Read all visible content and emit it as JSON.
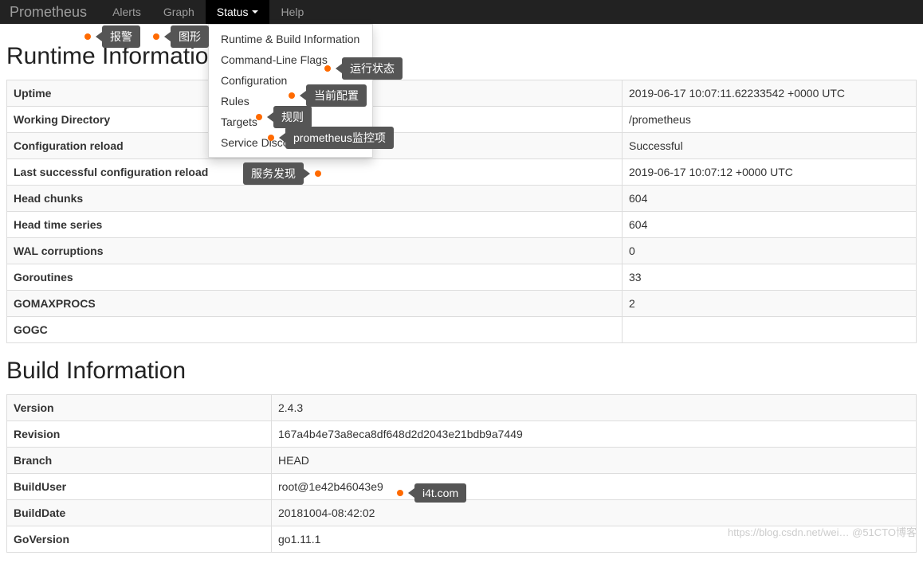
{
  "nav": {
    "brand": "Prometheus",
    "alerts": "Alerts",
    "graph": "Graph",
    "status": "Status",
    "help": "Help"
  },
  "dropdown": {
    "runtime_build": "Runtime & Build Information",
    "cmdline": "Command-Line Flags",
    "config": "Configuration",
    "rules": "Rules",
    "targets": "Targets",
    "sd": "Service Discovery"
  },
  "headings": {
    "runtime": "Runtime Information",
    "build": "Build Information"
  },
  "runtime": {
    "uptime_label": "Uptime",
    "uptime_value": "2019-06-17 10:07:11.62233542 +0000 UTC",
    "workdir_label": "Working Directory",
    "workdir_value": "/prometheus",
    "cfgreload_label": "Configuration reload",
    "cfgreload_value": "Successful",
    "lastcfg_label": "Last successful configuration reload",
    "lastcfg_value": "2019-06-17 10:07:12 +0000 UTC",
    "headchunks_label": "Head chunks",
    "headchunks_value": "604",
    "headseries_label": "Head time series",
    "headseries_value": "604",
    "wal_label": "WAL corruptions",
    "wal_value": "0",
    "goroutines_label": "Goroutines",
    "goroutines_value": "33",
    "gomaxprocs_label": "GOMAXPROCS",
    "gomaxprocs_value": "2",
    "gogc_label": "GOGC",
    "gogc_value": ""
  },
  "build": {
    "version_label": "Version",
    "version_value": "2.4.3",
    "revision_label": "Revision",
    "revision_value": "167a4b4e73a8eca8df648d2d2043e21bdb9a7449",
    "branch_label": "Branch",
    "branch_value": "HEAD",
    "builduser_label": "BuildUser",
    "builduser_value": "root@1e42b46043e9",
    "builddate_label": "BuildDate",
    "builddate_value": "20181004-08:42:02",
    "goversion_label": "GoVersion",
    "goversion_value": "go1.11.1"
  },
  "annotations": {
    "alerts": "报警",
    "graph": "图形",
    "cmdline": "运行状态",
    "config": "当前配置",
    "rules": "规则",
    "targets": "prometheus监控项",
    "sd": "服务发现",
    "builddate": "i4t.com"
  },
  "watermark": "https://blog.csdn.net/wei… @51CTO博客"
}
